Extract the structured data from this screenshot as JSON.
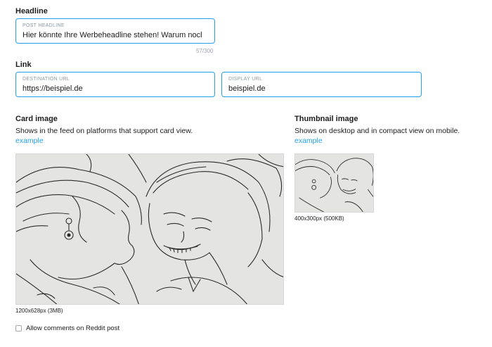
{
  "headline_section": {
    "title": "Headline",
    "field_label": "POST HEADLINE",
    "value": "Hier könnte Ihre Werbeheadline stehen! Warum nocl",
    "counter": "57/300"
  },
  "link_section": {
    "title": "Link",
    "destination_label": "DESTINATION URL",
    "destination_value": "https://beispiel.de",
    "display_label": "DISPLAY URL",
    "display_value": "beispiel.de"
  },
  "card_image": {
    "title": "Card image",
    "description": "Shows in the feed on platforms that support card view.",
    "example_link": "example",
    "size_note": "1200x628px (3MB)"
  },
  "thumbnail_image": {
    "title": "Thumbnail image",
    "description": "Shows on desktop and in compact view on mobile.",
    "example_link": "example",
    "size_note": "400x300px (500KB)"
  },
  "comments": {
    "label": "Allow comments on Reddit post",
    "checked": false
  },
  "colors": {
    "accent": "#24a0ed",
    "text": "#1c1c1c",
    "muted": "#8e9aa3"
  }
}
